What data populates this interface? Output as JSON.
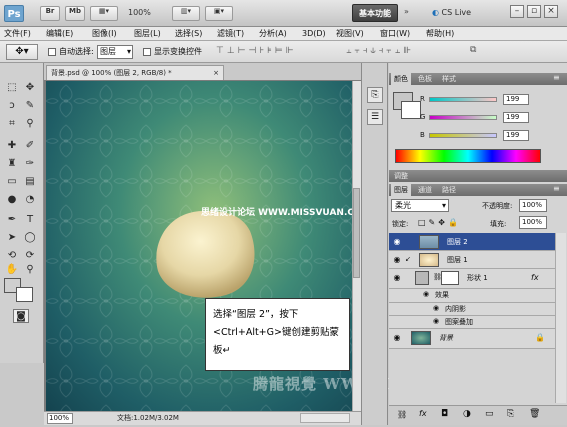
{
  "app": {
    "logo_text": "Ps",
    "zoom": "100%",
    "workspace_label": "基本功能",
    "cs_live": "CS Live"
  },
  "menu": [
    "文件(F)",
    "编辑(E)",
    "图像(I)",
    "图层(L)",
    "选择(S)",
    "滤镜(T)",
    "分析(A)",
    "3D(D)",
    "视图(V)",
    "窗口(W)",
    "帮助(H)"
  ],
  "options": {
    "auto_select_label": "自动选择:",
    "auto_select_value": "图层",
    "show_transform_label": "显示变换控件"
  },
  "document": {
    "tab_title": "背景.psd @ 100% (图层 2, RGB/8) *",
    "zoom_status": "100%",
    "doc_info": "文档:1.02M/3.02M"
  },
  "callout_text": "选择“图层 2”，按下<Ctrl+Alt+G>键创建剪贴蒙板↵",
  "watermark_top": "思绪设计论坛 WWW.MISSVUAN.COM",
  "watermark_bottom": "腾龍視覺 WWW.TLVI.NET",
  "color_panel": {
    "tabs": [
      "颜色",
      "色板",
      "样式"
    ],
    "channels": [
      {
        "label": "R",
        "value": "199"
      },
      {
        "label": "G",
        "value": "199"
      },
      {
        "label": "B",
        "value": "199"
      }
    ],
    "swatch_color": "#c7c7c7"
  },
  "adjust_tab": "调整",
  "layers_panel": {
    "tabs": [
      "图层",
      "通道",
      "路径"
    ],
    "blend_mode": "柔光",
    "opacity_label": "不透明度:",
    "opacity_value": "100%",
    "lock_label": "锁定:",
    "fill_label": "填充:",
    "fill_value": "100%",
    "layers": [
      {
        "name": "图层 2",
        "selected": true
      },
      {
        "name": "图层 1",
        "selected": false
      },
      {
        "name": "形状 1",
        "selected": false,
        "fx": "fx"
      },
      {
        "name": "效果",
        "sub": true
      },
      {
        "name": "内阴影",
        "sub": true
      },
      {
        "name": "图案叠加",
        "sub": true
      },
      {
        "name": "背景",
        "selected": false,
        "locked": true
      }
    ]
  }
}
